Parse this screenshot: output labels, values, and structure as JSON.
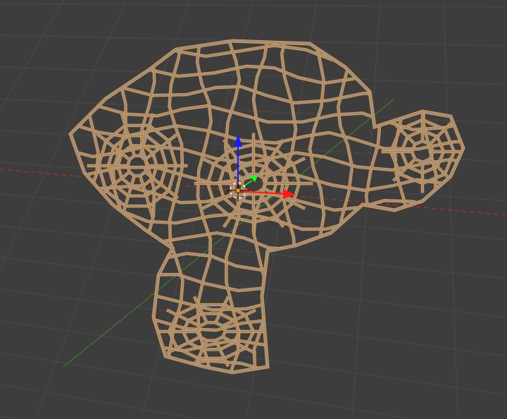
{
  "viewport": {
    "background_color": "#3d3d3d",
    "grid_color": "#4a4a4a",
    "x_axis_color": "#c0282d",
    "y_axis_color": "#3f8a2a",
    "view": "perspective"
  },
  "object": {
    "display_mode": "wireframe",
    "selected": true,
    "selection_outline_color": "#f0982c",
    "wire_color": "#8e8e96"
  },
  "gizmo": {
    "type": "translate",
    "z_arrow_color": "#1a1aff",
    "x_arrow_color": "#ff1a1a",
    "y_arrow_color": "#1aff1a",
    "cursor_icon": "3d-cursor-icon",
    "origin_color": "#f0982c"
  }
}
